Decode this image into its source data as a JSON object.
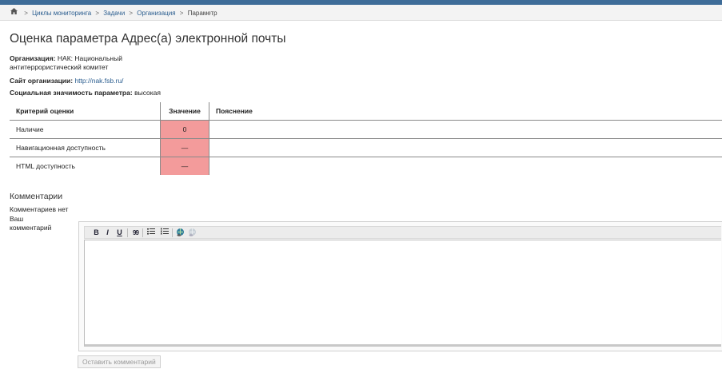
{
  "breadcrumb": {
    "items": [
      "Циклы мониторинга",
      "Задачи",
      "Организация"
    ],
    "current": "Параметр",
    "separator": ">"
  },
  "page": {
    "title": "Оценка параметра Адрес(а) электронной почты"
  },
  "info": {
    "org_label": "Организация:",
    "org_value_line1": "НАК: Национальный",
    "org_value_line2": "антитеррористический комитет",
    "site_label": "Сайт организации:",
    "site_value": "http://nak.fsb.ru/",
    "significance_label": "Социальная значимость параметра:",
    "significance_value": "высокая"
  },
  "table": {
    "headers": [
      "Критерий оценки",
      "Значение",
      "Пояснение"
    ],
    "rows": [
      {
        "criterion": "Наличие",
        "value": "0",
        "note": ""
      },
      {
        "criterion": "Навигационная доступность",
        "value": "—",
        "note": ""
      },
      {
        "criterion": "HTML доступность",
        "value": "—",
        "note": ""
      }
    ]
  },
  "comments": {
    "heading": "Комментарии",
    "none_text": "Комментариев нет",
    "your_label_line1": "Ваш",
    "your_label_line2": "комментарий",
    "submit_label": "Оставить комментарий"
  },
  "toolbar": {
    "bold": "B",
    "italic": "I",
    "underline": "U",
    "quote": "99"
  },
  "colors": {
    "topbar": "#3e6c98",
    "link": "#2a5d8f",
    "value_cell": "#f39b9b"
  }
}
